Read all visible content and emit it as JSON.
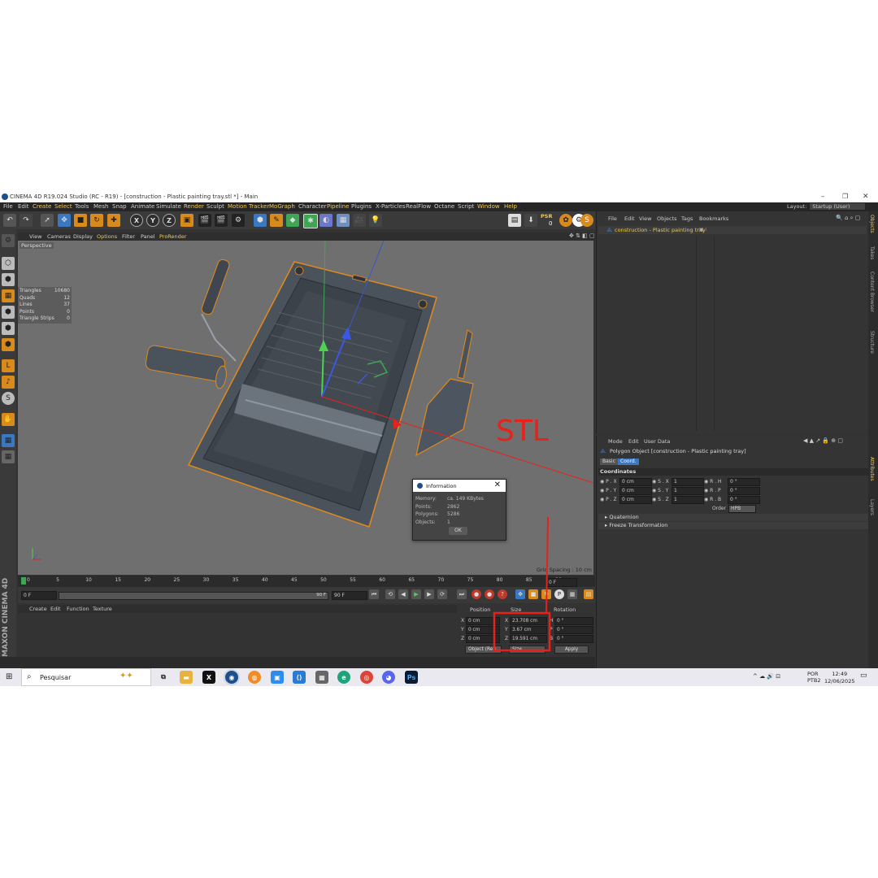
{
  "window": {
    "title": "CINEMA 4D R19.024 Studio (RC - R19) - [construction - Plastic painting tray.stl *] - Main"
  },
  "menu": [
    {
      "label": "File",
      "hl": false
    },
    {
      "label": "Edit",
      "hl": false
    },
    {
      "label": "Create",
      "hl": true
    },
    {
      "label": "Select",
      "hl": true
    },
    {
      "label": "Tools",
      "hl": false
    },
    {
      "label": "Mesh",
      "hl": false
    },
    {
      "label": "Snap",
      "hl": false
    },
    {
      "label": "Animate",
      "hl": false
    },
    {
      "label": "Simulate",
      "hl": false
    },
    {
      "label": "Render",
      "hl": true
    },
    {
      "label": "Sculpt",
      "hl": false
    },
    {
      "label": "Motion Tracker",
      "hl": true
    },
    {
      "label": "MoGraph",
      "hl": true
    },
    {
      "label": "Character",
      "hl": false
    },
    {
      "label": "Pipeline",
      "hl": true
    },
    {
      "label": "Plugins",
      "hl": false
    },
    {
      "label": "X-Particles",
      "hl": false
    },
    {
      "label": "RealFlow",
      "hl": false
    },
    {
      "label": "Octane",
      "hl": false
    },
    {
      "label": "Script",
      "hl": false
    },
    {
      "label": "Window",
      "hl": true
    },
    {
      "label": "Help",
      "hl": true
    }
  ],
  "layout": {
    "label": "Layout:",
    "value": "Startup (User)"
  },
  "toolbar": {
    "axis_x": "X",
    "axis_y": "Y",
    "axis_z": "Z",
    "psr_label": "PSR",
    "psr_value": "0"
  },
  "viewport": {
    "menu": [
      {
        "label": "View",
        "hl": false
      },
      {
        "label": "Cameras",
        "hl": false
      },
      {
        "label": "Display",
        "hl": false
      },
      {
        "label": "Options",
        "hl": true
      },
      {
        "label": "Filter",
        "hl": false
      },
      {
        "label": "Panel",
        "hl": false
      },
      {
        "label": "ProRender",
        "hl": true
      }
    ],
    "label": "Perspective",
    "stats": [
      {
        "name": "Triangles",
        "value": "10680"
      },
      {
        "name": "Quads",
        "value": "12"
      },
      {
        "name": "Lines",
        "value": "37"
      },
      {
        "name": "Points",
        "value": "0"
      },
      {
        "name": "Triangle Strips",
        "value": "0"
      }
    ],
    "grid_spacing": "Grid Spacing : 10 cm",
    "annotation": "STL"
  },
  "dialog": {
    "title": "Information",
    "rows": [
      {
        "label": "Memory:",
        "value": "ca. 149 KBytes"
      },
      {
        "label": "Points:",
        "value": "2862"
      },
      {
        "label": "Polygons:",
        "value": "5286"
      },
      {
        "label": "Objects:",
        "value": "1"
      }
    ],
    "ok_label": "OK"
  },
  "timeline": {
    "ticks": [
      "0",
      "5",
      "10",
      "15",
      "20",
      "25",
      "30",
      "35",
      "40",
      "45",
      "50",
      "55",
      "60",
      "65",
      "70",
      "75",
      "80",
      "85",
      "90"
    ],
    "current_frame": "0 F",
    "start_frame": "0 F",
    "end_frame": "90 F",
    "range_end": "90 F",
    "end_frame_right": "90 F"
  },
  "material_menu": [
    "Create",
    "Edit",
    "Function",
    "Texture"
  ],
  "brand": "MAXON CINEMA 4D",
  "coordinates": {
    "headers": [
      "Position",
      "Size",
      "Rotation"
    ],
    "rows": [
      {
        "axis": "X",
        "pos": "0 cm",
        "size_axis": "X",
        "size": "23.708 cm",
        "rot_axis": "H",
        "rot": "0 °"
      },
      {
        "axis": "Y",
        "pos": "0 cm",
        "size_axis": "Y",
        "size": "3.67 cm",
        "rot_axis": "P",
        "rot": "0 °"
      },
      {
        "axis": "Z",
        "pos": "0 cm",
        "size_axis": "Z",
        "size": "19.591 cm",
        "rot_axis": "B",
        "rot": "0 °"
      }
    ],
    "mode_value": "Object (Rel)",
    "size_mode_value": "Size",
    "apply_label": "Apply"
  },
  "object_manager": {
    "menu": [
      "File",
      "Edit",
      "View",
      "Objects",
      "Tags",
      "Bookmarks"
    ],
    "object_name": "construction - Plastic painting tray"
  },
  "attribute_manager": {
    "menu": [
      "Mode",
      "Edit",
      "User Data"
    ],
    "object_line": "Polygon Object [construction - Plastic painting tray]",
    "tabs": [
      "Basic",
      "Coord."
    ],
    "section": "Coordinates",
    "rows": [
      {
        "p": "P . X",
        "pv": "0 cm",
        "s": "S . X",
        "sv": "1",
        "r": "R . H",
        "rv": "0 °"
      },
      {
        "p": "P . Y",
        "pv": "0 cm",
        "s": "S . Y",
        "sv": "1",
        "r": "R . P",
        "rv": "0 °"
      },
      {
        "p": "P . Z",
        "pv": "0 cm",
        "s": "S . Z",
        "sv": "1",
        "r": "R . B",
        "rv": "0 °"
      }
    ],
    "order_label": "Order",
    "order_value": "HPB",
    "groups": [
      "Quaternion",
      "Freeze Transformation"
    ]
  },
  "side_tabs": [
    "Objects",
    "Takes",
    "Content Browser",
    "Structure"
  ],
  "side_tabs_bottom": [
    "Attributes",
    "Layers"
  ],
  "taskbar": {
    "search_placeholder": "Pesquisar",
    "lang_top": "POR",
    "lang_bottom": "PTB2",
    "time": "12:49",
    "date": "12/06/2025"
  },
  "colors": {
    "accent": "#f2c94c",
    "selection": "#3a78c2",
    "annotation": "#e8211a",
    "object_outline": "#e08a1e"
  }
}
